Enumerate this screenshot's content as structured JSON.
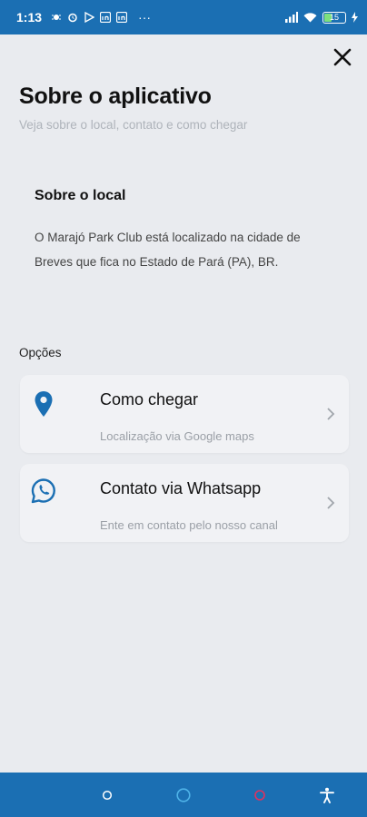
{
  "status_bar": {
    "time": "1:13",
    "battery": "15",
    "more": "···"
  },
  "header": {
    "title": "Sobre o aplicativo",
    "subtitle": "Veja sobre o local, contato e como chegar"
  },
  "about": {
    "heading": "Sobre o local",
    "text": "O Marajó Park Club está localizado na cidade de Breves que fica no Estado de Pará (PA), BR."
  },
  "options": {
    "label": "Opções",
    "items": [
      {
        "title": "Como chegar",
        "subtitle": "Localização via Google maps",
        "icon": "location-pin-icon"
      },
      {
        "title": "Contato via Whatsapp",
        "subtitle": "Ente em contato pelo nosso canal",
        "icon": "whatsapp-icon"
      }
    ]
  },
  "colors": {
    "primary": "#1b6fb3",
    "background": "#e9ebef",
    "card": "#f1f2f5"
  }
}
